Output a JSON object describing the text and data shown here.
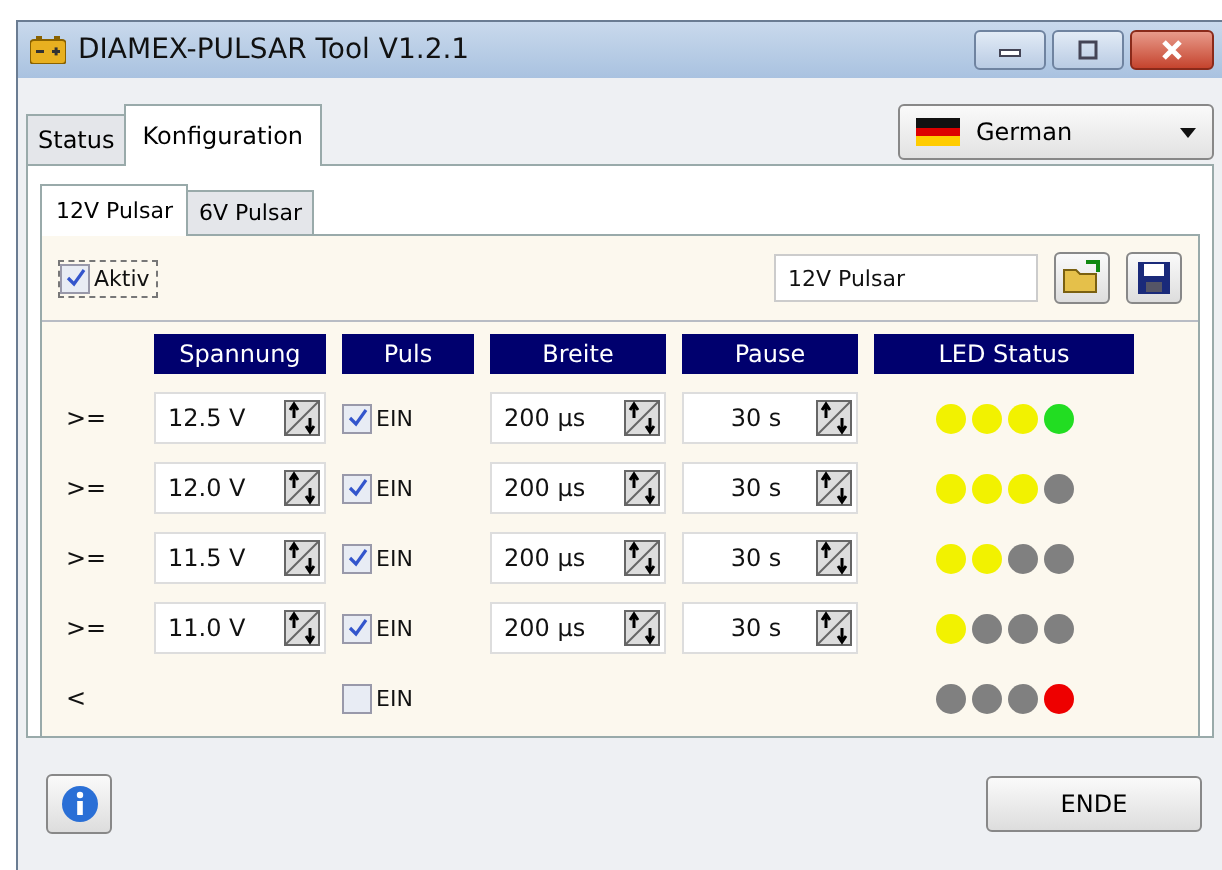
{
  "window": {
    "title": "DIAMEX-PULSAR Tool V1.2.1"
  },
  "tabs": [
    {
      "label": "Status",
      "selected": false
    },
    {
      "label": "Konfiguration",
      "selected": true
    }
  ],
  "language": {
    "value": "German"
  },
  "subtabs": [
    {
      "label": "12V Pulsar",
      "selected": true
    },
    {
      "label": "6V Pulsar",
      "selected": false
    }
  ],
  "active": {
    "label": "Aktiv",
    "checked": true
  },
  "profile_name": {
    "value": "12V Pulsar"
  },
  "columns": [
    "Spannung",
    "Puls",
    "Breite",
    "Pause",
    "LED Status"
  ],
  "rows": [
    {
      "kind": "threshold",
      "operator": ">=",
      "voltage": "12.5 V",
      "pulse": {
        "label": "EIN",
        "checked": true
      },
      "width": "200 µs",
      "pause": "30 s",
      "leds": [
        {
          "color": "#f2f200"
        },
        {
          "color": "#f2f200"
        },
        {
          "color": "#f2f200"
        },
        {
          "color": "#22dd22"
        }
      ]
    },
    {
      "kind": "threshold",
      "operator": ">=",
      "voltage": "12.0 V",
      "pulse": {
        "label": "EIN",
        "checked": true
      },
      "width": "200 µs",
      "pause": "30 s",
      "leds": [
        {
          "color": "#f2f200"
        },
        {
          "color": "#f2f200"
        },
        {
          "color": "#f2f200"
        },
        {
          "color": "#808080"
        }
      ]
    },
    {
      "kind": "threshold",
      "operator": ">=",
      "voltage": "11.5 V",
      "pulse": {
        "label": "EIN",
        "checked": true
      },
      "width": "200 µs",
      "pause": "30 s",
      "leds": [
        {
          "color": "#f2f200"
        },
        {
          "color": "#f2f200"
        },
        {
          "color": "#808080"
        },
        {
          "color": "#808080"
        }
      ]
    },
    {
      "kind": "threshold",
      "operator": ">=",
      "voltage": "11.0 V",
      "pulse": {
        "label": "EIN",
        "checked": true
      },
      "width": "200 µs",
      "pause": "30 s",
      "leds": [
        {
          "color": "#f2f200"
        },
        {
          "color": "#808080"
        },
        {
          "color": "#808080"
        },
        {
          "color": "#808080"
        }
      ]
    },
    {
      "kind": "below",
      "operator": "<",
      "pulse": {
        "label": "EIN",
        "checked": false
      },
      "leds": [
        {
          "color": "#808080"
        },
        {
          "color": "#808080"
        },
        {
          "color": "#808080"
        },
        {
          "color": "#ee0000"
        }
      ]
    }
  ],
  "buttons": [
    {
      "label": "ENDE"
    }
  ]
}
